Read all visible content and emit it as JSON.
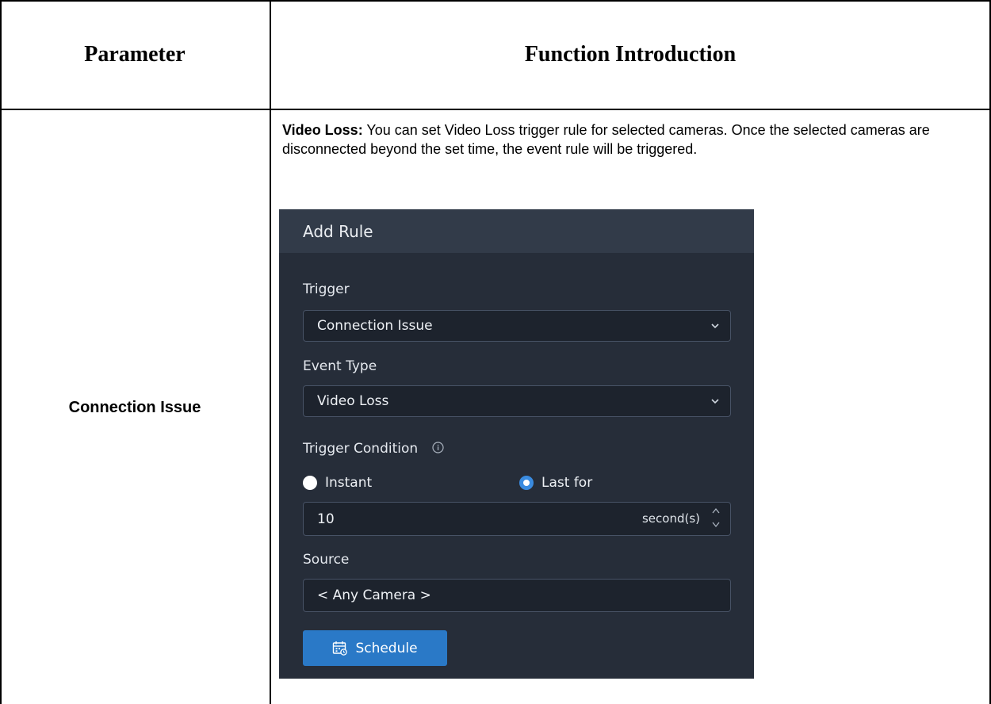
{
  "table": {
    "header_parameter": "Parameter",
    "header_function": "Function Introduction",
    "parameter": "Connection Issue"
  },
  "description": {
    "term": "Video Loss:",
    "text": " You can set Video Loss trigger rule for selected cameras. Once the selected cameras are disconnected beyond the set time, the event rule will be triggered."
  },
  "dialog": {
    "title": "Add Rule",
    "trigger_label": "Trigger",
    "trigger_value": "Connection Issue",
    "event_type_label": "Event Type",
    "event_type_value": "Video Loss",
    "trigger_condition_label": "Trigger Condition",
    "radio_instant": "Instant",
    "radio_last_for": "Last for",
    "selected_radio": "Last for",
    "duration_value": "10",
    "duration_unit": "second(s)",
    "source_label": "Source",
    "source_value": "< Any Camera >",
    "schedule_button": "Schedule"
  },
  "colors": {
    "dialog_bg": "#262d39",
    "dialog_header_bg": "#323b49",
    "field_bg": "#1d232d",
    "accent": "#2a79c7"
  },
  "icons": {
    "dropdown": "chevron-down-icon",
    "info": "info-circle-icon",
    "spinner": "spinner-arrows-icon",
    "schedule": "calendar-icon"
  }
}
